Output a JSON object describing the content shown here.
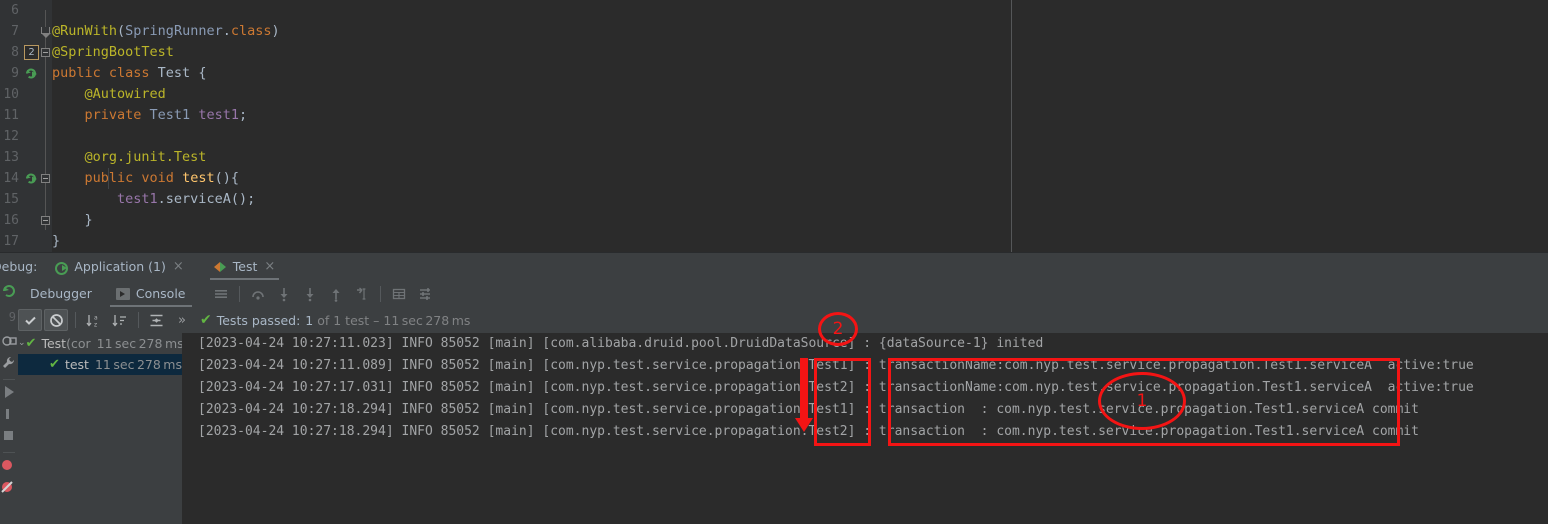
{
  "editor": {
    "lines": [
      {
        "num": "6",
        "marker": null,
        "fold": "tri-top-partial",
        "tokens": []
      },
      {
        "num": "7",
        "marker": null,
        "fold": "tri",
        "tokens": [
          {
            "t": "@RunWith",
            "c": "c-ann"
          },
          {
            "t": "(",
            "c": "c-plain"
          },
          {
            "t": "SpringRunner",
            "c": "c-type"
          },
          {
            "t": ".",
            "c": "c-plain"
          },
          {
            "t": "class",
            "c": "c-kw"
          },
          {
            "t": ")",
            "c": "c-plain"
          }
        ]
      },
      {
        "num": "8",
        "marker": "badge-2",
        "fold": "mark",
        "tokens": [
          {
            "t": "@SpringBootTest",
            "c": "c-ann"
          }
        ]
      },
      {
        "num": "9",
        "marker": "run",
        "fold": null,
        "tokens": [
          {
            "t": "public class ",
            "c": "c-kw"
          },
          {
            "t": "Test",
            "c": "c-plain"
          },
          {
            "t": " {",
            "c": "c-plain"
          }
        ]
      },
      {
        "num": "10",
        "marker": null,
        "fold": null,
        "tokens": [
          {
            "t": "    @Autowired",
            "c": "c-ann"
          }
        ]
      },
      {
        "num": "11",
        "marker": null,
        "fold": null,
        "tokens": [
          {
            "t": "    ",
            "c": "c-plain"
          },
          {
            "t": "private ",
            "c": "c-kw"
          },
          {
            "t": "Test1",
            "c": "c-type"
          },
          {
            "t": " ",
            "c": "c-plain"
          },
          {
            "t": "test1",
            "c": "c-fld"
          },
          {
            "t": ";",
            "c": "c-plain"
          }
        ]
      },
      {
        "num": "12",
        "marker": null,
        "fold": null,
        "tokens": []
      },
      {
        "num": "13",
        "marker": null,
        "fold": null,
        "tokens": [
          {
            "t": "    @org.junit.",
            "c": "c-ann"
          },
          {
            "t": "Test",
            "c": "c-ann-t"
          }
        ]
      },
      {
        "num": "14",
        "marker": "run",
        "fold": "mark",
        "tokens": [
          {
            "t": "    ",
            "c": "c-plain"
          },
          {
            "t": "public void ",
            "c": "c-kw"
          },
          {
            "t": "test",
            "c": "c-meth"
          },
          {
            "t": "(){",
            "c": "c-plain"
          }
        ]
      },
      {
        "num": "15",
        "marker": null,
        "fold": null,
        "tokens": [
          {
            "t": "        ",
            "c": "c-plain"
          },
          {
            "t": "test1",
            "c": "c-fld"
          },
          {
            "t": ".serviceA();",
            "c": "c-plain"
          }
        ]
      },
      {
        "num": "16",
        "marker": null,
        "fold": "mark",
        "tokens": [
          {
            "t": "    }",
            "c": "c-plain"
          }
        ]
      },
      {
        "num": "17",
        "marker": null,
        "fold": null,
        "tokens": [
          {
            "t": "}",
            "c": "c-plain"
          }
        ]
      }
    ]
  },
  "debug": {
    "label": "Debug:",
    "tabs": [
      {
        "name": "Application (1)",
        "icon": "application-run-icon",
        "selected": false,
        "close": "×"
      },
      {
        "name": "Test",
        "icon": "junit-icon",
        "selected": true,
        "close": "×"
      }
    ],
    "subtabs": [
      {
        "name": "Debugger",
        "selected": false
      },
      {
        "name": "Console",
        "selected": true,
        "icon": "console-icon"
      }
    ],
    "toolbar_icons": [
      "menu-icon",
      "step-over-icon",
      "step-into-icon",
      "force-step-into-icon",
      "step-out-icon",
      "run-to-cursor-icon",
      "evaluate-table-icon",
      "settings-lines-icon"
    ],
    "test_toolbar_icons": [
      "show-passed-icon",
      "show-ignored-icon",
      "sort-alphabetically-icon",
      "sort-by-duration-icon",
      "expand-collapse-icon",
      "more-icon"
    ],
    "status": {
      "check": "✔",
      "label": "Tests passed:",
      "count": "1",
      "of_text": " of 1 test – ",
      "duration": "11 sec 278 ms"
    },
    "tree": [
      {
        "arrow": "⌄",
        "check": "✔",
        "label": "Test",
        "meta": "(cor",
        "duration": "11 sec 278 ms",
        "selected": false
      },
      {
        "arrow": "",
        "check": "✔",
        "label": "test",
        "meta": "",
        "duration": "11 sec 278 ms",
        "selected": true
      }
    ]
  },
  "console": {
    "lines": [
      "[2023-04-24 10:27:11.023] INFO 85052 [main] [com.alibaba.druid.pool.DruidDataSource] : {dataSource-1} inited",
      "[2023-04-24 10:27:11.089] INFO 85052 [main] [com.nyp.test.service.propagation.Test1] : transactionName:com.nyp.test.service.propagation.Test1.serviceA  active:true",
      "[2023-04-24 10:27:17.031] INFO 85052 [main] [com.nyp.test.service.propagation.Test2] : transactionName:com.nyp.test.service.propagation.Test1.serviceA  active:true",
      "[2023-04-24 10:27:18.294] INFO 85052 [main] [com.nyp.test.service.propagation.Test1] : transaction  : com.nyp.test.service.propagation.Test1.serviceA commit",
      "[2023-04-24 10:27:18.294] INFO 85052 [main] [com.nyp.test.service.propagation.Test2] : transaction  : com.nyp.test.service.propagation.Test1.serviceA commit"
    ]
  },
  "annotations": {
    "color": "#f41414",
    "circle_1_label": "1",
    "circle_2_label": "2"
  }
}
